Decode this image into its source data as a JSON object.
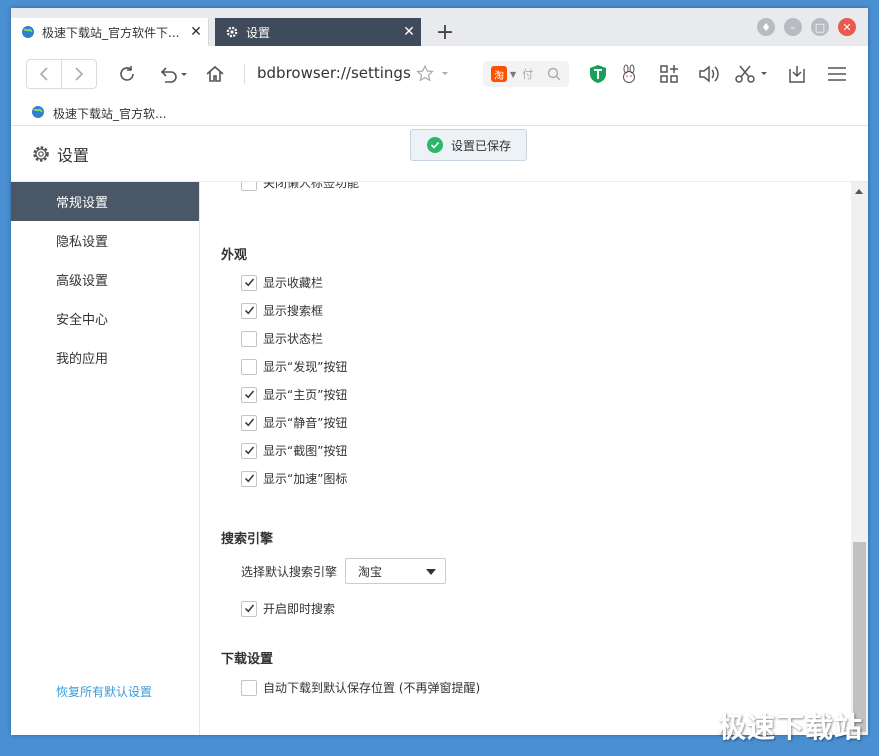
{
  "tabs": [
    {
      "title": "极速下载站_官方软件下...",
      "active": false
    },
    {
      "title": "设置",
      "active": true
    }
  ],
  "toolbar": {
    "url": "bdbrowser://settings",
    "search_engine_badge": "淘",
    "search_placeholder": "付"
  },
  "bookmarks": [
    {
      "label": "极速下载站_官方软..."
    }
  ],
  "page": {
    "title": "设置",
    "toast": "设置已保存"
  },
  "sidebar": {
    "items": [
      {
        "label": "常规设置",
        "active": true
      },
      {
        "label": "隐私设置",
        "active": false
      },
      {
        "label": "高级设置",
        "active": false
      },
      {
        "label": "安全中心",
        "active": false
      },
      {
        "label": "我的应用",
        "active": false
      }
    ],
    "restore_label": "恢复所有默认设置"
  },
  "content": {
    "partial_item": {
      "label": "关闭懒人标签功能",
      "checked": false
    },
    "appearance": {
      "title": "外观",
      "items": [
        {
          "label": "显示收藏栏",
          "checked": true
        },
        {
          "label": "显示搜索框",
          "checked": true
        },
        {
          "label": "显示状态栏",
          "checked": false
        },
        {
          "label": "显示“发现”按钮",
          "checked": false
        },
        {
          "label": "显示“主页”按钮",
          "checked": true
        },
        {
          "label": "显示“静音”按钮",
          "checked": true
        },
        {
          "label": "显示“截图”按钮",
          "checked": true
        },
        {
          "label": "显示“加速”图标",
          "checked": true
        }
      ]
    },
    "search": {
      "title": "搜索引擎",
      "select_label": "选择默认搜索引擎",
      "select_value": "淘宝",
      "instant": {
        "label": "开启即时搜索",
        "checked": true
      }
    },
    "download": {
      "title": "下载设置",
      "auto": {
        "label": "自动下载到默认保存位置 (不再弹窗提醒)",
        "checked": false
      }
    }
  },
  "watermark": "极速下载站"
}
